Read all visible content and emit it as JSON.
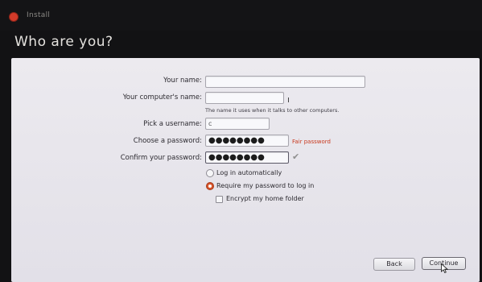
{
  "window": {
    "title": "Install"
  },
  "page": {
    "title": "Who are you?"
  },
  "form": {
    "your_name_label": "Your name:",
    "your_name_value": "",
    "computer_name_label": "Your computer's name:",
    "computer_name_value": "",
    "computer_name_hint": "The name it uses when it talks to other computers.",
    "username_label": "Pick a username:",
    "username_value": "c",
    "password_label": "Choose a password:",
    "password_value": "●●●●●●●●",
    "password_strength": "Fair password",
    "confirm_label": "Confirm your password:",
    "confirm_value": "●●●●●●●●",
    "login_auto_label": "Log in automatically",
    "login_require_label": "Require my password to log in",
    "encrypt_label": "Encrypt my home folder"
  },
  "buttons": {
    "back": "Back",
    "continue": "Continue"
  },
  "colors": {
    "accent": "#d8542a",
    "warning": "#c8391e",
    "panel": "#e8e6ec"
  }
}
